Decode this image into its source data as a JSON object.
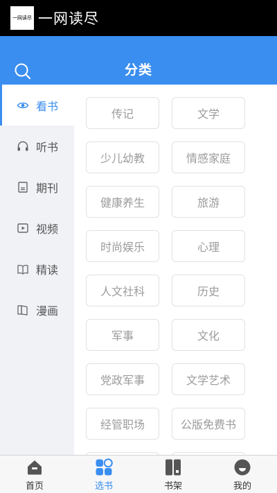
{
  "app": {
    "logo_text": "一网读尽",
    "title": "一网读尽"
  },
  "header": {
    "title": "分类",
    "search_icon": "search-icon",
    "background": "#3a8ef0"
  },
  "sidebar": {
    "active_index": 0,
    "items": [
      {
        "label": "看书",
        "icon": "eye-icon"
      },
      {
        "label": "听书",
        "icon": "headphones-icon"
      },
      {
        "label": "期刊",
        "icon": "magazine-icon"
      },
      {
        "label": "视频",
        "icon": "video-icon"
      },
      {
        "label": "精读",
        "icon": "open-book-icon"
      },
      {
        "label": "漫画",
        "icon": "comic-book-icon"
      }
    ]
  },
  "categories": [
    "传记",
    "文学",
    "少儿幼教",
    "情感家庭",
    "健康养生",
    "旅游",
    "时尚娱乐",
    "心理",
    "人文社科",
    "历史",
    "军事",
    "文化",
    "党政军事",
    "文学艺术",
    "经管职场",
    "公版免费书"
  ],
  "tabbar": {
    "active_index": 1,
    "accent_color": "#3a8ef0",
    "tabs": [
      {
        "label": "首页",
        "icon": "home-icon"
      },
      {
        "label": "选书",
        "icon": "grid-icon"
      },
      {
        "label": "书架",
        "icon": "bookshelf-icon"
      },
      {
        "label": "我的",
        "icon": "profile-icon"
      }
    ]
  }
}
